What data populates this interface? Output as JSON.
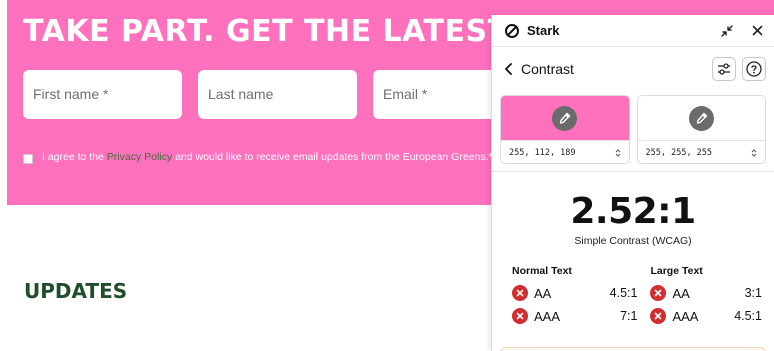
{
  "page": {
    "hero_title": "TAKE PART. GET THE LATEST FRO",
    "fields": [
      {
        "placeholder": "First name *"
      },
      {
        "placeholder": "Last name"
      },
      {
        "placeholder": "Email *"
      }
    ],
    "consent": {
      "before": "I agree to the ",
      "link": "Privacy Policy",
      "after": " and would like to receive email updates from the European Greens.*"
    },
    "updates_heading": "UPDATES"
  },
  "panel": {
    "brand": "Stark",
    "icons": {
      "logo": "stark-logo-icon",
      "minimize": "minimize-icon",
      "close": "close-icon"
    },
    "nav": {
      "title": "Contrast",
      "back": "chevron-left-icon",
      "settings": "sliders-icon",
      "help": "help-icon"
    },
    "foreground": {
      "color": "#ff70bd",
      "value": "255, 112, 189"
    },
    "background": {
      "color": "#ffffff",
      "value": "255, 255, 255"
    },
    "ratio": "2.52:1",
    "ratio_caption": "Simple Contrast (WCAG)",
    "normal_text": {
      "heading": "Normal Text",
      "rows": [
        {
          "level": "AA",
          "requirement": "4.5:1",
          "status": "fail"
        },
        {
          "level": "AAA",
          "requirement": "7:1",
          "status": "fail"
        }
      ]
    },
    "large_text": {
      "heading": "Large Text",
      "rows": [
        {
          "level": "AA",
          "requirement": "3:1",
          "status": "fail"
        },
        {
          "level": "AAA",
          "requirement": "4.5:1",
          "status": "fail"
        }
      ]
    },
    "colors": {
      "fail": "#d12f2f",
      "accent_pink": "#ff70bd"
    }
  }
}
